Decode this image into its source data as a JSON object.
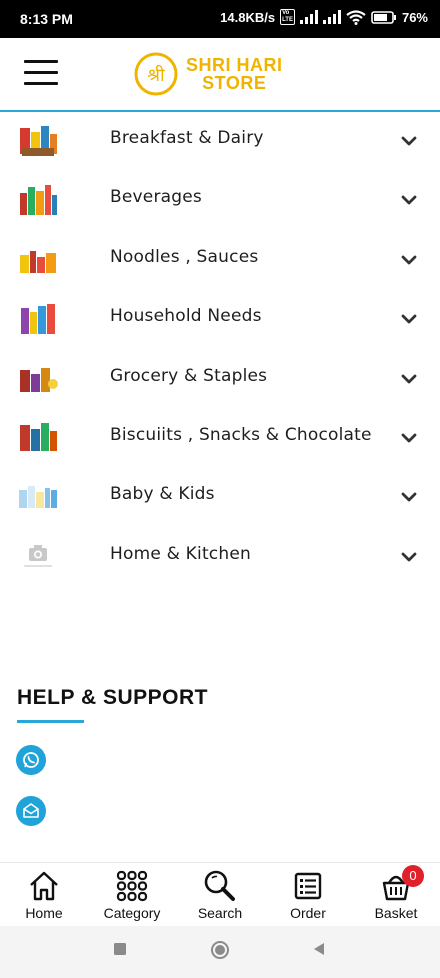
{
  "status_bar": {
    "time": "8:13 PM",
    "net_speed": "14.8KB/s",
    "volte": "Vo LTE",
    "battery": "76%"
  },
  "header": {
    "logo_mark": "श्री",
    "logo_line1": "SHRI HARI",
    "logo_line2": "STORE",
    "accent_color": "#29a8d8",
    "logo_color": "#f0b400"
  },
  "categories": [
    {
      "label": "Breakfast & Dairy",
      "icon": "breakfast-thumb"
    },
    {
      "label": "Beverages",
      "icon": "beverages-thumb"
    },
    {
      "label": "Noodles , Sauces",
      "icon": "noodles-thumb"
    },
    {
      "label": "Household Needs",
      "icon": "household-thumb"
    },
    {
      "label": "Grocery & Staples",
      "icon": "grocery-thumb"
    },
    {
      "label": "Biscuiits , Snacks & Chocolate",
      "icon": "snacks-thumb"
    },
    {
      "label": "Baby & Kids",
      "icon": "baby-thumb"
    },
    {
      "label": "Home & Kitchen",
      "icon": "camera-placeholder-icon"
    }
  ],
  "help": {
    "title": "HELP & SUPPORT",
    "items": [
      {
        "icon": "whatsapp-icon"
      },
      {
        "icon": "mail-icon"
      }
    ]
  },
  "bottom_nav": {
    "home": "Home",
    "category": "Category",
    "search": "Search",
    "order": "Order",
    "basket": "Basket",
    "basket_count": "0",
    "basket_multiplier": "x0"
  }
}
